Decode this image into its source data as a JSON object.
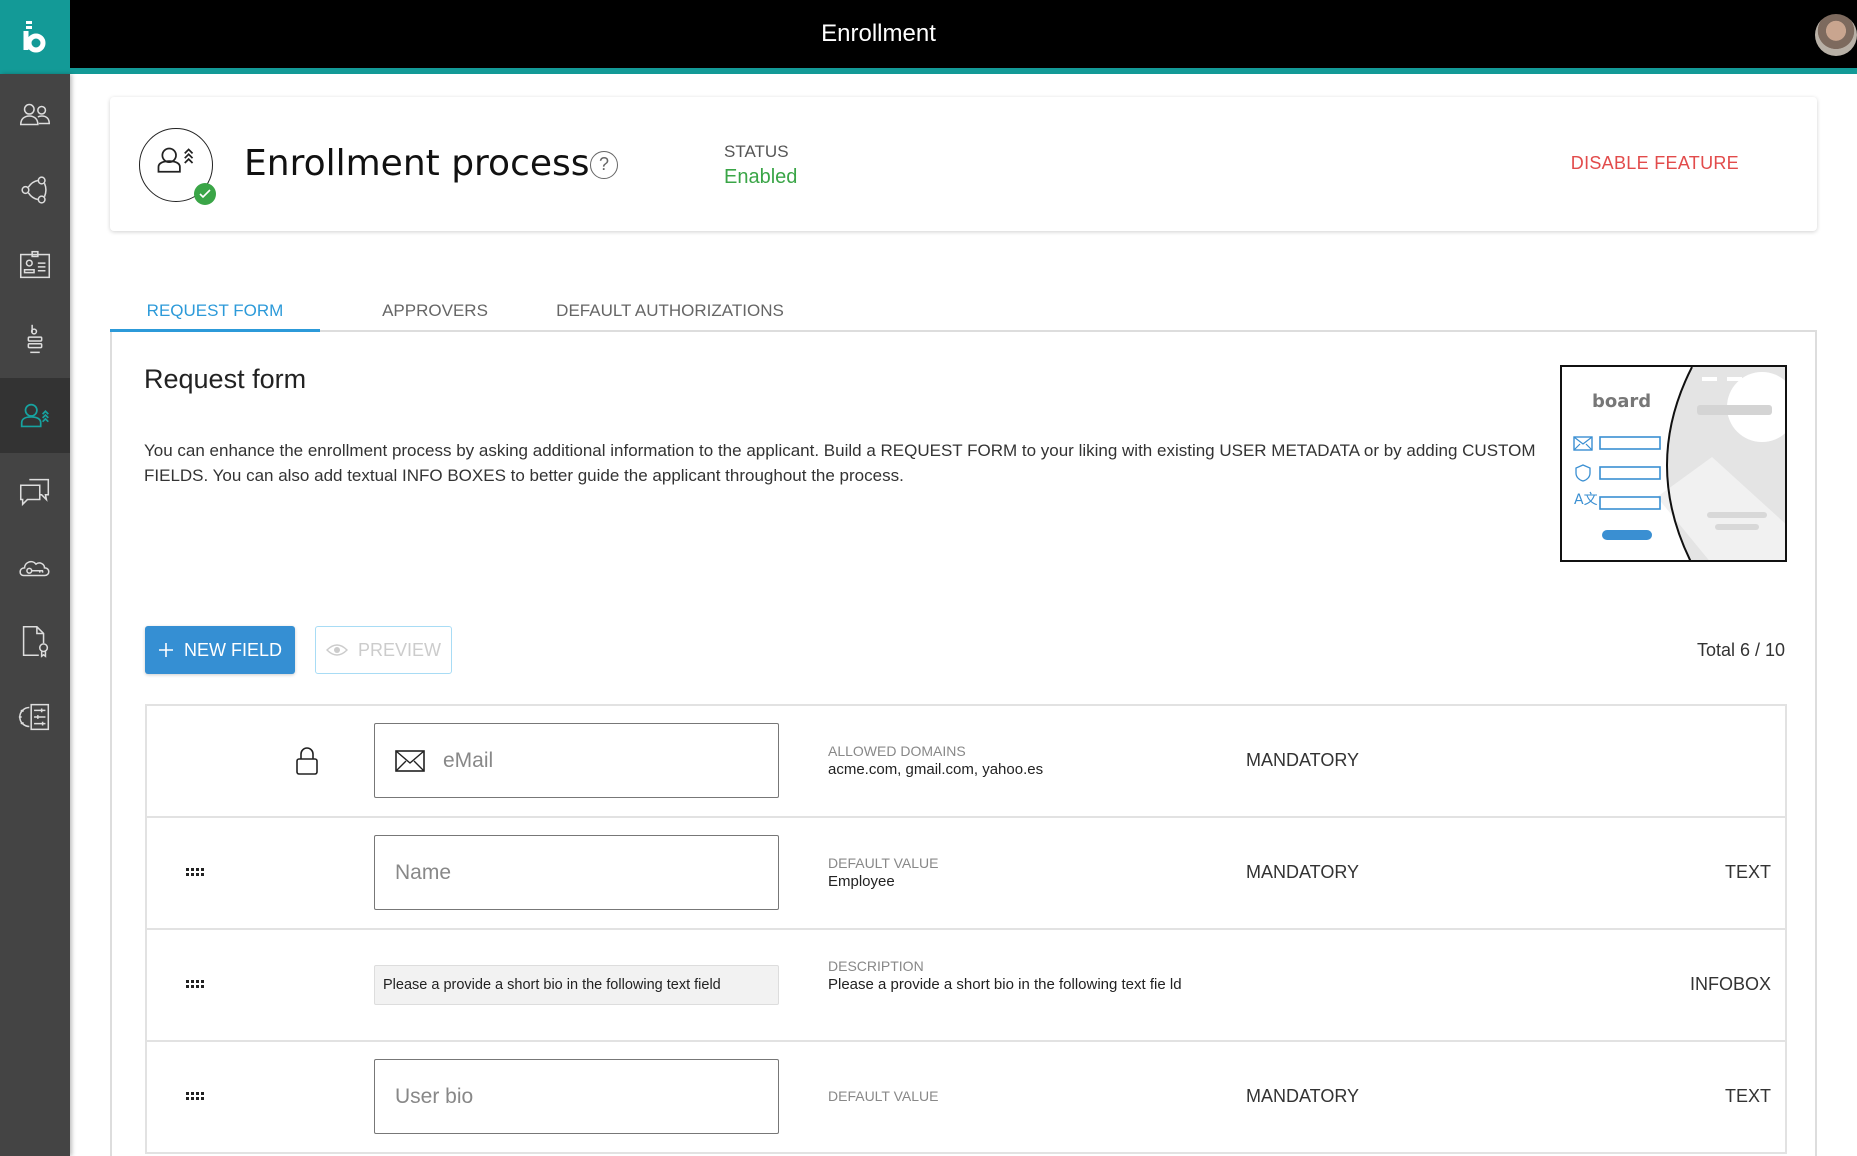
{
  "app": {
    "title": "Enrollment",
    "logo_icon": "board-b-logo",
    "avatar_icon": "user-avatar-photo"
  },
  "sidebar": {
    "items": [
      {
        "name": "users",
        "icon": "users-icon",
        "active": false
      },
      {
        "name": "network",
        "icon": "share-nodes-icon",
        "active": false
      },
      {
        "name": "id-card",
        "icon": "id-card-icon",
        "active": false
      },
      {
        "name": "board-servers",
        "icon": "board-stack-icon",
        "active": false
      },
      {
        "name": "enrollment",
        "icon": "user-enroll-icon",
        "active": true
      },
      {
        "name": "messages",
        "icon": "chat-bubbles-icon",
        "active": false
      },
      {
        "name": "cloud-keys",
        "icon": "cloud-key-icon",
        "active": false
      },
      {
        "name": "licenses",
        "icon": "certificate-file-icon",
        "active": false
      },
      {
        "name": "settings",
        "icon": "gear-sliders-icon",
        "active": false
      }
    ]
  },
  "header_card": {
    "title": "Enrollment process",
    "help_symbol": "?",
    "status_label": "STATUS",
    "status_value": "Enabled",
    "disable_label": "DISABLE FEATURE"
  },
  "tabs": [
    {
      "label": "REQUEST FORM",
      "active": true
    },
    {
      "label": "APPROVERS",
      "active": false
    },
    {
      "label": "DEFAULT AUTHORIZATIONS",
      "active": false
    }
  ],
  "request_form": {
    "title": "Request form",
    "description": "You can enhance the enrollment process by asking additional information to the applicant. Build a REQUEST FORM to your liking with existing USER METADATA or by adding CUSTOM FIELDS. You can also add textual INFO BOXES to better guide the applicant throughout the process.",
    "illustration_brand": "board",
    "new_field_label": "NEW FIELD",
    "preview_label": "PREVIEW",
    "total_label": "Total 6 / 10",
    "fields": [
      {
        "handle": "lock",
        "label": "eMail",
        "meta_label": "ALLOWED DOMAINS",
        "meta_value": "acme.com, gmail.com, yahoo.es",
        "mandatory": "MANDATORY",
        "type": ""
      },
      {
        "handle": "drag",
        "label": "Name",
        "meta_label": "DEFAULT VALUE",
        "meta_value": "Employee",
        "mandatory": "MANDATORY",
        "type": "TEXT"
      },
      {
        "handle": "drag",
        "label": "Please a provide a short bio in the following text field",
        "meta_label": "DESCRIPTION",
        "meta_value": "Please a provide a short bio in the following text fie ld",
        "mandatory": "",
        "type": "INFOBOX"
      },
      {
        "handle": "drag",
        "label": "User bio",
        "meta_label": "DEFAULT VALUE",
        "meta_value": "",
        "mandatory": "MANDATORY",
        "type": "TEXT"
      }
    ]
  },
  "colors": {
    "brand_teal": "#139a97",
    "accent_blue": "#358fd3",
    "tab_active": "#2c9ad9",
    "status_green": "#3aa547",
    "danger_red": "#e24b4b"
  }
}
